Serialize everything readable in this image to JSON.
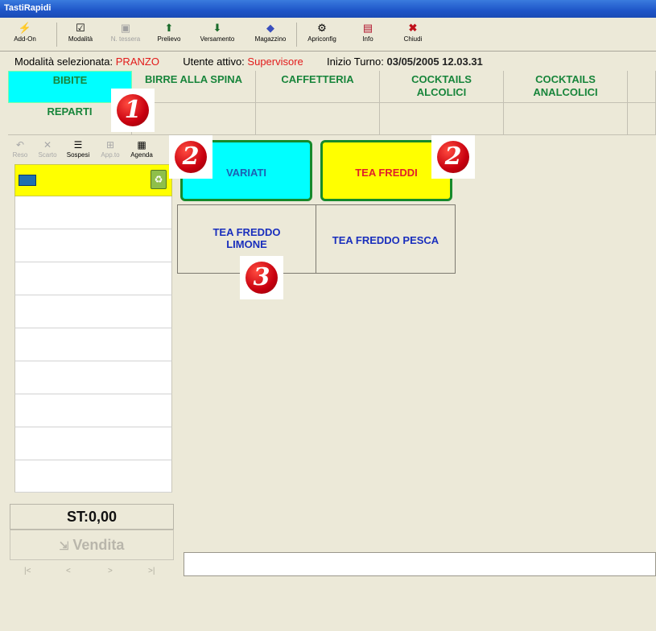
{
  "window": {
    "title": "TastiRapidi"
  },
  "toolbar": {
    "buttons": [
      {
        "label": "Add-On",
        "icon": "lightning-icon"
      },
      {
        "label": "Modalità",
        "icon": "edit-icon"
      },
      {
        "label": "N. tessera",
        "icon": "card-icon"
      },
      {
        "label": "Prelievo",
        "icon": "arrow-up-icon"
      },
      {
        "label": "Versamento",
        "icon": "arrow-down-icon"
      },
      {
        "label": "Magazzino",
        "icon": "boxes-icon"
      },
      {
        "label": "Apriconfig",
        "icon": "config-icon"
      },
      {
        "label": "Info",
        "icon": "info-icon"
      },
      {
        "label": "Chiudi",
        "icon": "close-icon"
      }
    ]
  },
  "status": {
    "mode_label": "Modalità selezionata:",
    "mode_value": "PRANZO",
    "user_label": "Utente attivo:",
    "user_value": "Supervisore",
    "shift_label": "Inizio Turno:",
    "shift_value": "03/05/2005 12.03.31"
  },
  "categories": [
    {
      "label": "BIBITE"
    },
    {
      "label": "BIRRE ALLA SPINA"
    },
    {
      "label": "CAFFETTERIA"
    },
    {
      "label": "COCKTAILS ALCOLICI"
    },
    {
      "label": "COCKTAILS ANALCOLICI"
    },
    {
      "label": "REPARTI"
    }
  ],
  "badges": {
    "one": "1",
    "two": "2",
    "three": "3"
  },
  "left_tools": [
    {
      "label": "Reso",
      "icon": "undo-icon"
    },
    {
      "label": "Scarto",
      "icon": "x-icon"
    },
    {
      "label": "Sospesi",
      "icon": "stack-icon"
    },
    {
      "label": "App.to",
      "icon": "calc-icon"
    },
    {
      "label": "Agenda",
      "icon": "agenda-icon"
    }
  ],
  "ticket": {
    "subtotal": "ST:0,00",
    "sell_button": "Vendita"
  },
  "products": [
    {
      "label": "VARIATI",
      "color": "#00ffff",
      "text_color": "#1d5fb3"
    },
    {
      "label": "TEA FREDDI",
      "color": "#ffff00",
      "text_color": "#e0202a"
    },
    {
      "label": "TEA FREDDO LIMONE",
      "color": "#ece9d8",
      "text_color": "#1a2fbd"
    },
    {
      "label": "TEA FREDDO PESCA",
      "color": "#ece9d8",
      "text_color": "#1a2fbd"
    }
  ],
  "nav": [
    "|<",
    "<",
    ">",
    ">|"
  ]
}
